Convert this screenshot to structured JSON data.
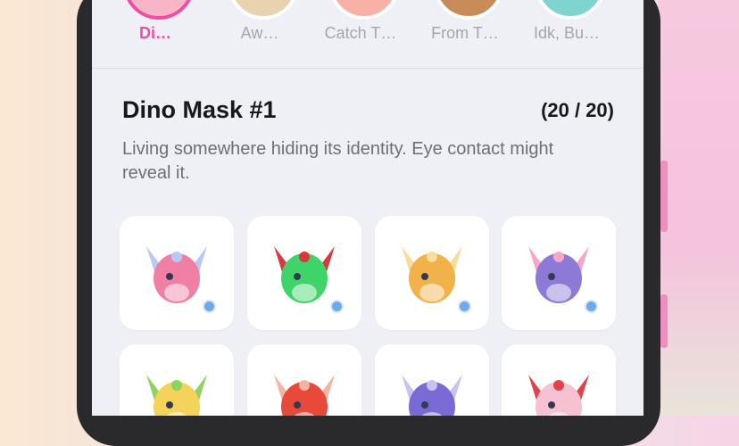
{
  "tabs": [
    {
      "label": "Di…",
      "active": true,
      "color": "#f6b6c8"
    },
    {
      "label": "Aw…",
      "active": false,
      "color": "#e8d2b0"
    },
    {
      "label": "Catch T…",
      "active": false,
      "color": "#f7b1a6"
    },
    {
      "label": "From T…",
      "active": false,
      "color": "#c98b57"
    },
    {
      "label": "Idk, Bu…",
      "active": false,
      "color": "#7fd4cf"
    }
  ],
  "collection": {
    "title": "Dino Mask #1",
    "count": "(20 / 20)",
    "description": "Living somewhere hiding its identity. Eye contact might reveal it."
  },
  "masks": [
    {
      "name": "pink-blue mask",
      "color": "#f07fa4",
      "accent": "#b9c8f4",
      "badge": true
    },
    {
      "name": "green holly mask",
      "color": "#3ed46a",
      "accent": "#d63a3a",
      "badge": true
    },
    {
      "name": "orange fox mask",
      "color": "#f2b24a",
      "accent": "#f7dc9a",
      "badge": true
    },
    {
      "name": "purple bow mask",
      "color": "#8d79d6",
      "accent": "#f4a7c7",
      "badge": true
    },
    {
      "name": "yellow flower mask",
      "color": "#f3d35a",
      "accent": "#8ed35d",
      "badge": false
    },
    {
      "name": "red mask",
      "color": "#e84a3a",
      "accent": "#f5b3a0",
      "badge": false
    },
    {
      "name": "violet mask",
      "color": "#7a6ad6",
      "accent": "#c9c1f4",
      "badge": false
    },
    {
      "name": "pink bow mask",
      "color": "#f6c2d2",
      "accent": "#e0424e",
      "badge": false
    }
  ],
  "colors": {
    "accent": "#ee4fa3",
    "badge": "#6fa9e8"
  }
}
